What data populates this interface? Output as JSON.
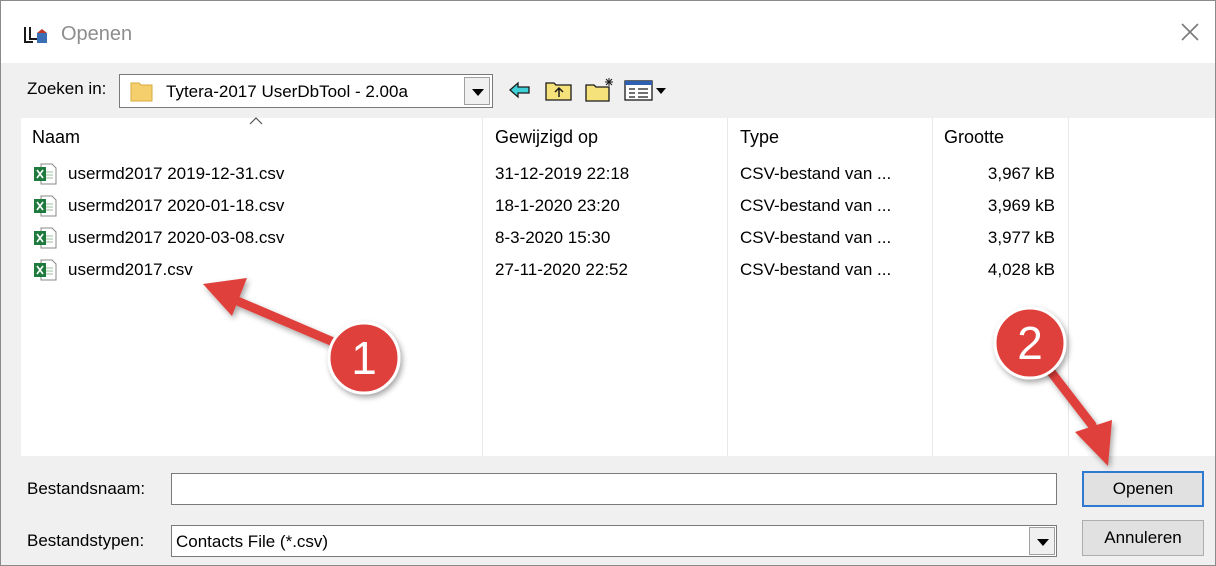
{
  "window": {
    "title": "Openen"
  },
  "toolbar": {
    "look_in_label": "Zoeken in:",
    "look_in_value": "Tytera-2017 UserDbTool - 2.00a",
    "icons": [
      "back-arrow-icon",
      "up-folder-icon",
      "new-folder-icon",
      "view-menu-icon"
    ]
  },
  "columns": [
    "Naam",
    "Gewijzigd op",
    "Type",
    "Grootte"
  ],
  "files": [
    {
      "name": "usermd2017 2019-12-31.csv",
      "modified": "31-12-2019 22:18",
      "type": "CSV-bestand van ...",
      "size": "3,967 kB"
    },
    {
      "name": "usermd2017 2020-01-18.csv",
      "modified": "18-1-2020 23:20",
      "type": "CSV-bestand van ...",
      "size": "3,969 kB"
    },
    {
      "name": "usermd2017 2020-03-08.csv",
      "modified": "8-3-2020 15:30",
      "type": "CSV-bestand van ...",
      "size": "3,977 kB"
    },
    {
      "name": "usermd2017.csv",
      "modified": "27-11-2020 22:52",
      "type": "CSV-bestand van ...",
      "size": "4,028 kB"
    }
  ],
  "filename": {
    "label": "Bestandsnaam:",
    "value": ""
  },
  "filetype": {
    "label": "Bestandstypen:",
    "value": "Contacts File (*.csv)"
  },
  "buttons": {
    "open": "Openen",
    "cancel": "Annuleren"
  },
  "annotations": [
    {
      "label": "1",
      "color": "#e0403a"
    },
    {
      "label": "2",
      "color": "#e0403a"
    }
  ]
}
